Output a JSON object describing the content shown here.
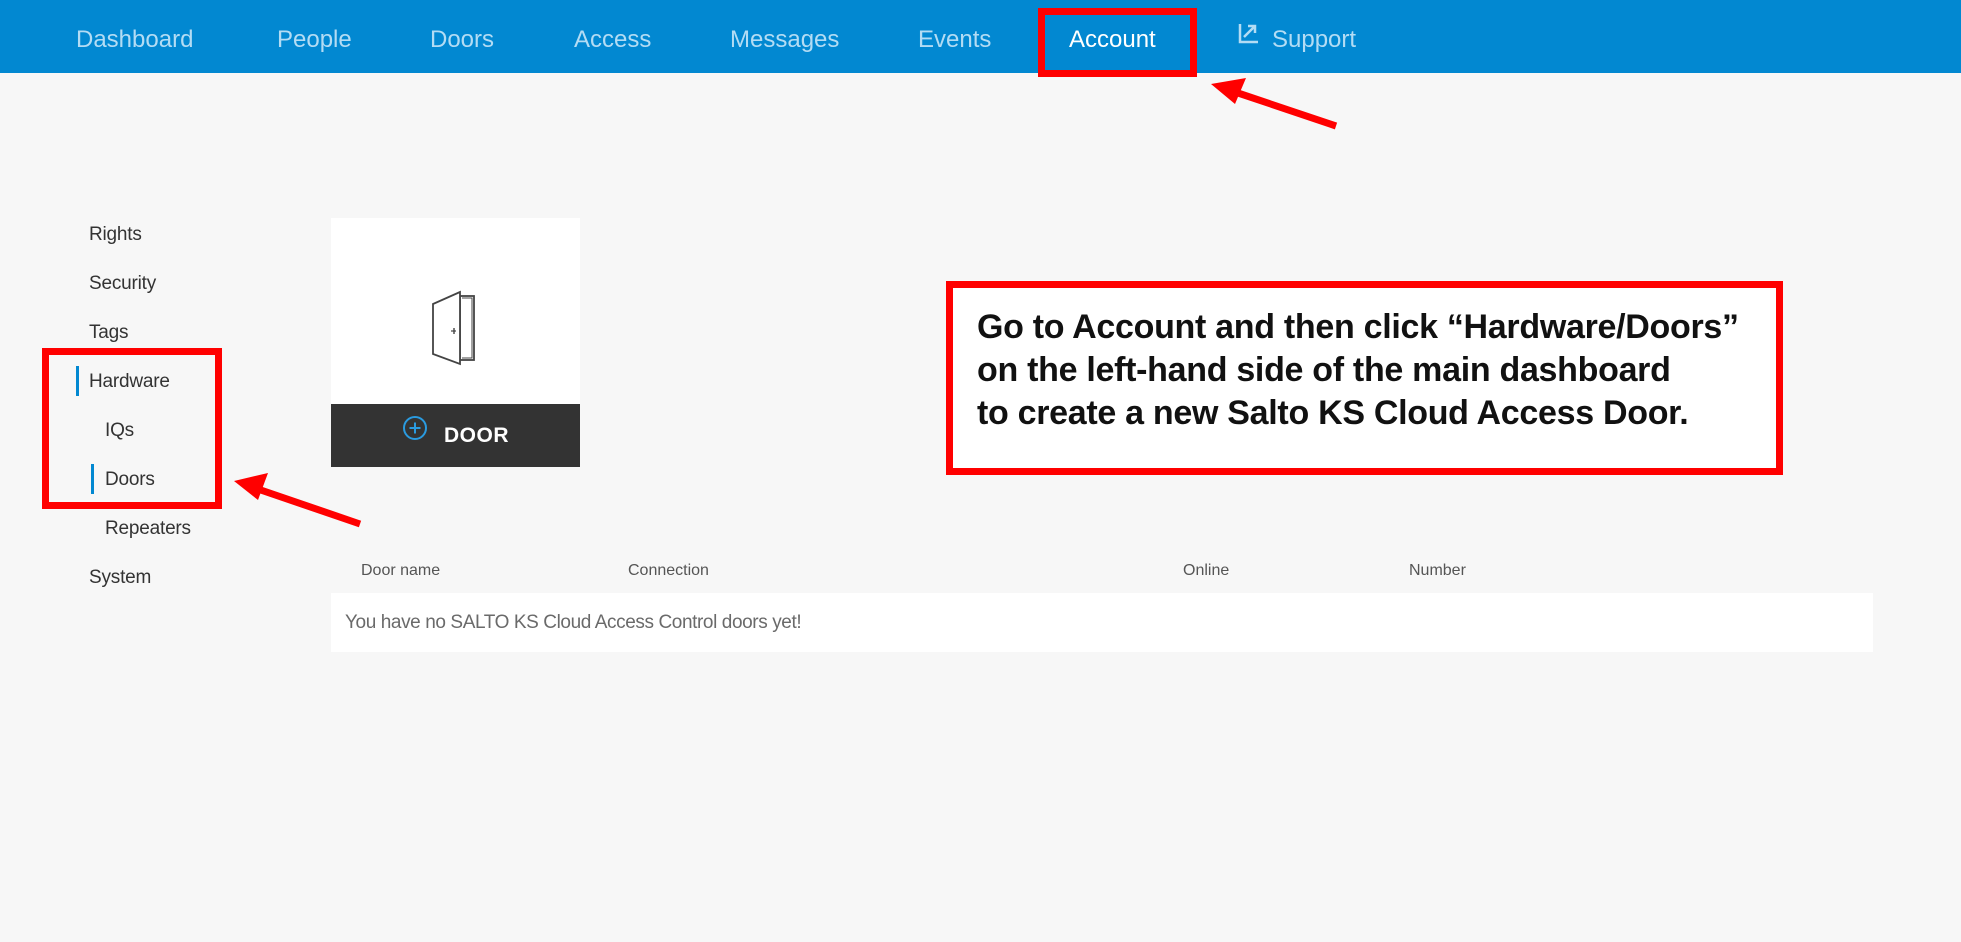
{
  "nav": {
    "items": [
      {
        "label": "Dashboard",
        "active": false
      },
      {
        "label": "People",
        "active": false
      },
      {
        "label": "Doors",
        "active": false
      },
      {
        "label": "Access",
        "active": false
      },
      {
        "label": "Messages",
        "active": false
      },
      {
        "label": "Events",
        "active": false
      },
      {
        "label": "Account",
        "active": true
      },
      {
        "label": "Support",
        "active": false,
        "icon": "external-link-icon"
      }
    ]
  },
  "sidebar": {
    "items": [
      {
        "label": "Rights"
      },
      {
        "label": "Security"
      },
      {
        "label": "Tags"
      },
      {
        "label": "Hardware",
        "selected": true
      },
      {
        "label": "IQs"
      },
      {
        "label": "Doors",
        "selected": true
      },
      {
        "label": "Repeaters"
      },
      {
        "label": "System"
      }
    ]
  },
  "door_card": {
    "icon": "door-icon",
    "button_icon": "plus-circle-icon",
    "button_label": "DOOR"
  },
  "table": {
    "columns": [
      "Door name",
      "Connection",
      "Online",
      "Number"
    ],
    "empty_message": "You have no SALTO KS Cloud Access Control doors yet!"
  },
  "annotation": {
    "lines": [
      "Go to Account and then click “Hardware/Doors”",
      "on the left-hand side of the main dashboard",
      "to create a new Salto KS Cloud Access Door."
    ]
  },
  "colors": {
    "nav_bg": "#0288d1",
    "accent": "#0288d1",
    "highlight": "#ff0000",
    "button_bg": "#333333"
  }
}
